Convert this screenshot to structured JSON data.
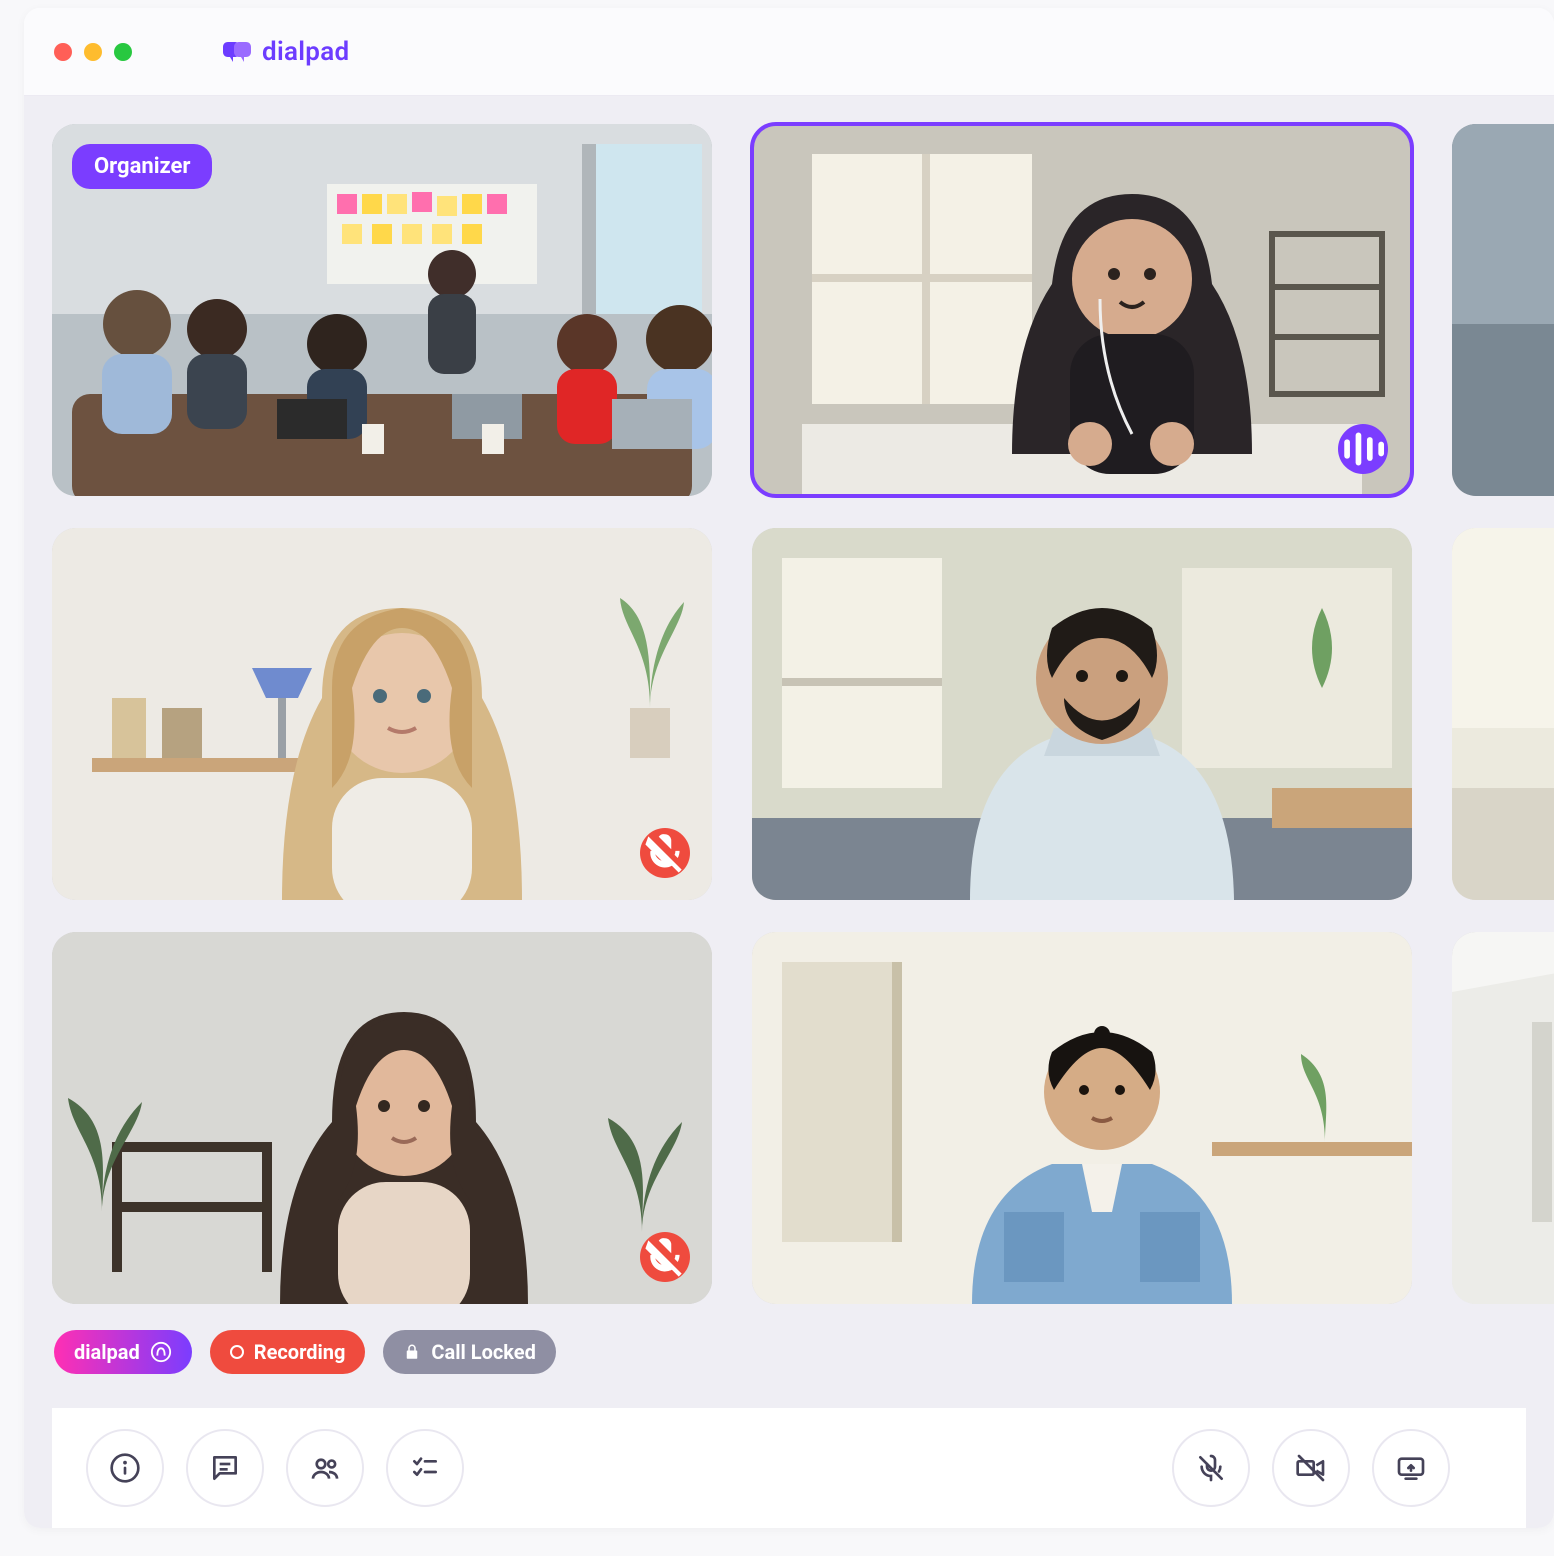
{
  "brand": "dialpad",
  "participants": [
    {
      "badge": "Organizer",
      "active": false,
      "muted": false
    },
    {
      "badge": null,
      "active": true,
      "speaking": true
    },
    {
      "badge": null,
      "active": false
    },
    {
      "badge": null,
      "active": false,
      "muted": true
    },
    {
      "badge": null,
      "active": false
    },
    {
      "badge": null,
      "active": false
    },
    {
      "badge": null,
      "active": false,
      "muted": true
    },
    {
      "badge": null,
      "active": false
    },
    {
      "badge": null,
      "active": false
    }
  ],
  "status": {
    "ai_label": "dialpad",
    "recording_label": "Recording",
    "locked_label": "Call Locked"
  },
  "icons": {
    "info": "info-icon",
    "chat": "chat-icon",
    "people": "people-icon",
    "tasks": "tasks-icon",
    "mic_off": "mic-off-icon",
    "cam_off": "camera-off-icon",
    "screen": "screen-share-icon"
  }
}
